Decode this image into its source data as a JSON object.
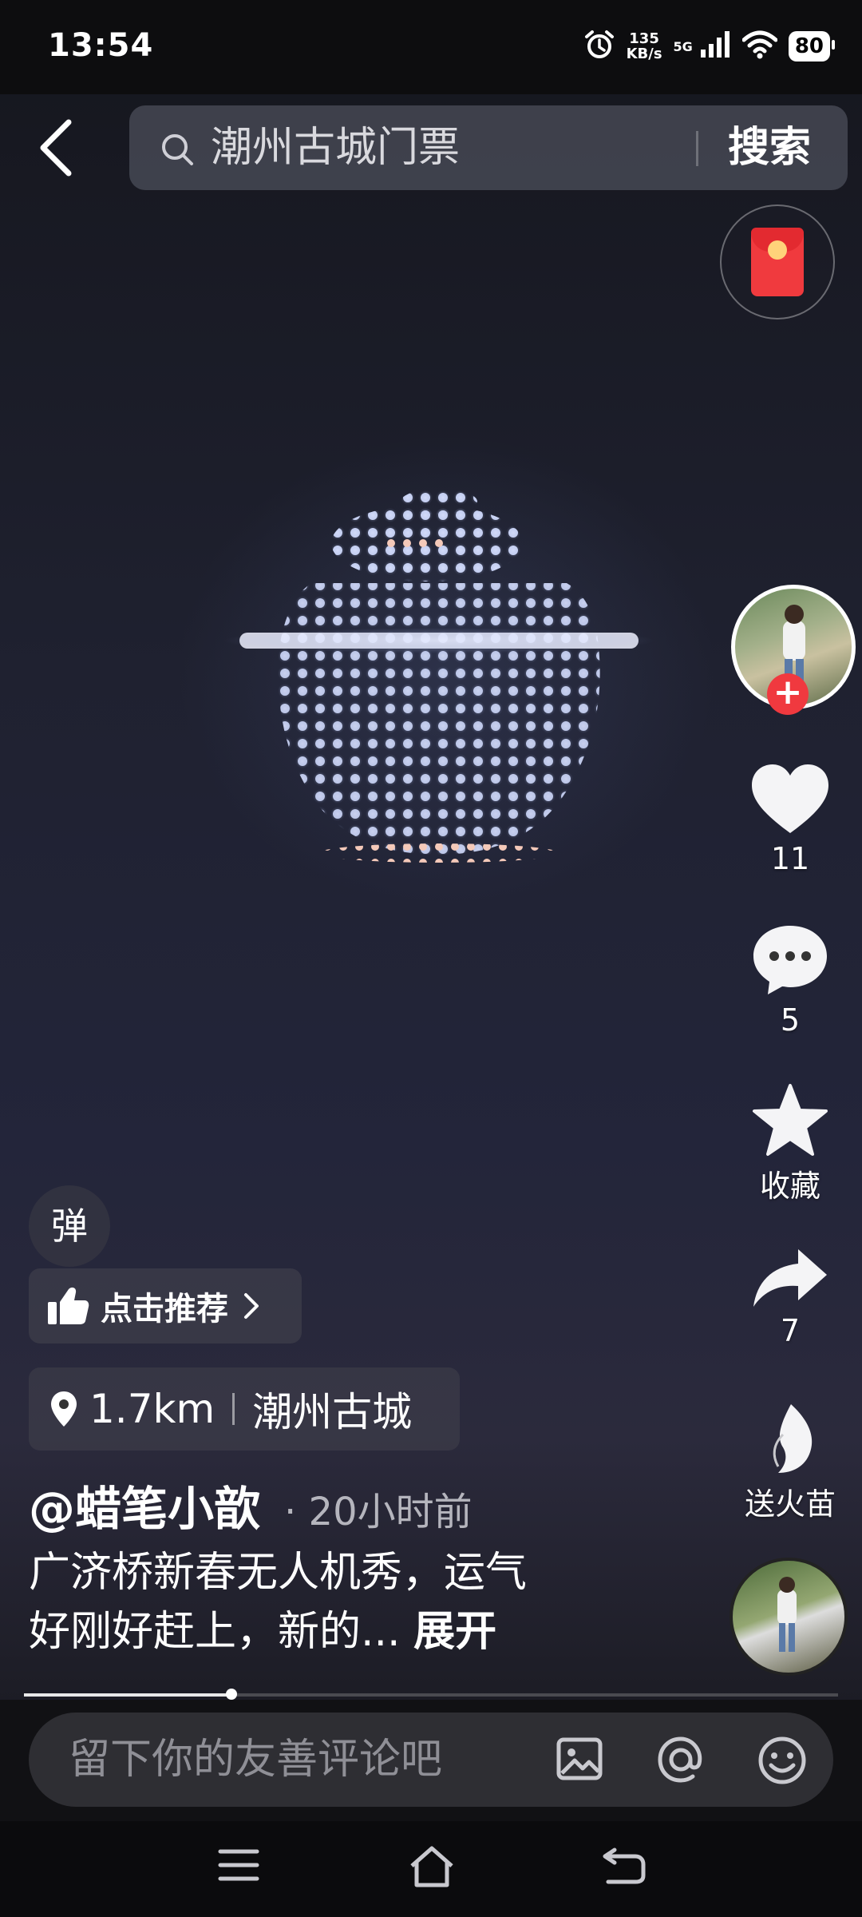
{
  "status_bar": {
    "time": "13:54",
    "net_speed_value": "135",
    "net_speed_unit": "KB/s",
    "network_type": "5G",
    "battery": "80"
  },
  "search": {
    "query": "潮州古城门票",
    "button_label": "搜索"
  },
  "actions": {
    "likes": "11",
    "comments": "5",
    "favorite_label": "收藏",
    "shares": "7",
    "gift_label": "送火苗"
  },
  "post": {
    "danmu_label": "弹",
    "recommend_label": "点击推荐",
    "location_distance": "1.7km",
    "location_name": "潮州古城",
    "author": "@蜡笔小歆",
    "time_ago": "· 20小时前",
    "description_line1": "广济桥新春无人机秀，运气",
    "description_line2": "好刚好赶上，新的...",
    "expand_label": "展开",
    "progress": 0.255
  },
  "comment_bar": {
    "placeholder": "留下你的友善评论吧"
  },
  "colors": {
    "accent_red": "#f0393f",
    "search_bg": "#5f6270",
    "comment_bg": "#2e2e33"
  }
}
